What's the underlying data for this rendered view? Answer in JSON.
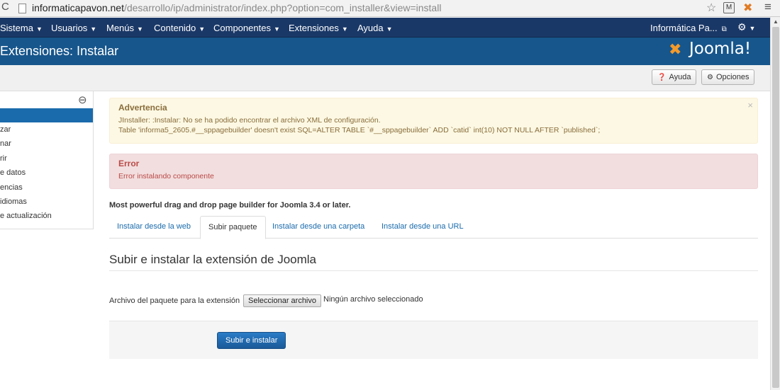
{
  "browser": {
    "url_domain": "informaticapavon.net",
    "url_path": "/desarrollo/ip/administrator/index.php?option=com_installer&view=install",
    "ext1_label": "M"
  },
  "navbar": {
    "items": [
      {
        "label": "Sistema"
      },
      {
        "label": "Usuarios"
      },
      {
        "label": "Menús"
      },
      {
        "label": "Contenido"
      },
      {
        "label": "Componentes"
      },
      {
        "label": "Extensiones"
      },
      {
        "label": "Ayuda"
      }
    ],
    "site_label": "Informática Pa..."
  },
  "header": {
    "title": "Extensiones: Instalar",
    "logo_text": "Joomla!"
  },
  "toolbar": {
    "help_label": "Ayuda",
    "options_label": "Opciones"
  },
  "sidebar": {
    "items": [
      {
        "label": ""
      },
      {
        "label": "zar"
      },
      {
        "label": "nar"
      },
      {
        "label": "rir"
      },
      {
        "label": "e datos"
      },
      {
        "label": "encias"
      },
      {
        "label": " idiomas"
      },
      {
        "label": "e actualización"
      }
    ]
  },
  "warning": {
    "heading": "Advertencia",
    "line1": "JInstaller: :Instalar: No se ha podido encontrar el archivo XML de configuración.",
    "line2": "Table 'informa5_2605.#__sppagebuilder' doesn't exist SQL=ALTER TABLE `#__sppagebuilder` ADD `catid` int(10) NOT NULL AFTER `published`;"
  },
  "error": {
    "heading": "Error",
    "message": "Error instalando componente"
  },
  "description": "Most powerful drag and drop page builder for Joomla 3.4 or later.",
  "tabs": [
    {
      "label": "Instalar desde la web"
    },
    {
      "label": "Subir paquete"
    },
    {
      "label": "Instalar desde una carpeta"
    },
    {
      "label": "Instalar desde una URL"
    }
  ],
  "upload": {
    "title": "Subir e instalar la extensión de Joomla",
    "file_label": "Archivo del paquete para la extensión",
    "file_button": "Seleccionar archivo",
    "file_status": "Ningún archivo seleccionado",
    "submit_label": "Subir e instalar"
  },
  "colors": {
    "navbar": "#1a3867",
    "header": "#17568c",
    "accent": "#1a6bac"
  }
}
